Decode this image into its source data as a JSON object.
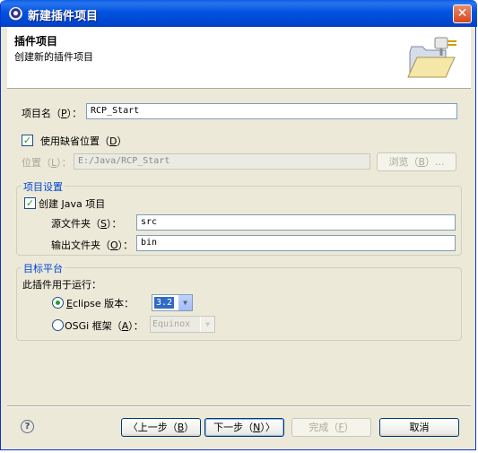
{
  "window": {
    "title": "新建插件项目",
    "close_glyph": "✕"
  },
  "header": {
    "title": "插件项目",
    "description": "创建新的插件项目"
  },
  "project_name": {
    "label_pre": "项目名（",
    "label_key": "P",
    "label_post": "）：",
    "value": "RCP_Start"
  },
  "default_location": {
    "label_pre": "使用缺省位置（",
    "label_key": "D",
    "label_post": "）",
    "checked": true
  },
  "location": {
    "label_pre": "位置（",
    "label_key": "L",
    "label_post": "）：",
    "value": "E:/Java/RCP_Start",
    "browse_pre": "浏览（",
    "browse_key": "B",
    "browse_post": "）..."
  },
  "project_settings": {
    "group_title": "项目设置",
    "create_java_pre": "创建 ",
    "create_java_key": "J",
    "create_java_post": "ava 项目",
    "create_java_checked": true,
    "source_pre": "源文件夹（",
    "source_key": "S",
    "source_post": "）：",
    "source_value": "src",
    "output_pre": "输出文件夹（",
    "output_key": "O",
    "output_post": "）：",
    "output_value": "bin"
  },
  "target_platform": {
    "group_title": "目标平台",
    "runs_with_label": "此插件用于运行：",
    "eclipse_key": "E",
    "eclipse_post": "clipse 版本：",
    "eclipse_version": "3.2",
    "eclipse_selected": true,
    "osgi_pre": "OSGi 框架（",
    "osgi_key": "A",
    "osgi_post": "）：",
    "osgi_value": "Equinox"
  },
  "footer": {
    "help_glyph": "?",
    "back_pre": "〈上一步（",
    "back_key": "B",
    "back_post": "）",
    "next_pre": "下一步（",
    "next_key": "N",
    "next_post": "）〉",
    "finish_pre": "完成（",
    "finish_key": "F",
    "finish_post": "）",
    "cancel": "取消"
  },
  "colors": {
    "title_blue": "#0053e0",
    "group_title": "#0046d5",
    "dialog_bg": "#ece9d8",
    "check_green": "#21a121"
  },
  "icons": [
    "eclipse-logo-icon",
    "close-icon",
    "folder-plug-icon",
    "help-icon",
    "chevron-down-icon"
  ]
}
